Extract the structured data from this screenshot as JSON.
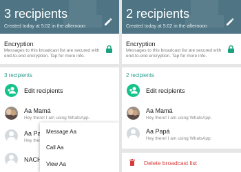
{
  "left": {
    "title": "3 recipients",
    "subtitle": "Created today at 5:02 in the afternoon",
    "encryption_title": "Encryption",
    "encryption_text": "Messages to this broadcast list are secured with end-to-end encryption. Tap for more info.",
    "recipients_count": "3 recipients",
    "edit_recipients": "Edit recipients",
    "contacts": [
      {
        "name": "Aa Mamá",
        "status": "Hey there! I am using WhatsApp."
      },
      {
        "name": "Aa Pap",
        "status": "Hey there!"
      },
      {
        "name": "NACHO",
        "status": ""
      }
    ],
    "menu": [
      "Message Aa",
      "Call Aa",
      "View Aa"
    ]
  },
  "right": {
    "title": "2 recipients",
    "subtitle": "Created today at 5:02 in the afternoon",
    "encryption_title": "Encryption",
    "encryption_text": "Messages to this broadcast list are secured with end-to-end encryption. Tap for more info.",
    "recipients_count": "2 recipients",
    "edit_recipients": "Edit recipients",
    "contacts": [
      {
        "name": "Aa Mamá",
        "status": "Hey there! I am using WhatsApp."
      },
      {
        "name": "Aa Papá",
        "status": "Hey there! I am using WhatsApp."
      }
    ],
    "delete_label": "Delete broadcast list"
  },
  "colors": {
    "header": "#4f7584",
    "accent": "#2b9c8c",
    "green": "#14c28a",
    "danger": "#d63b3b"
  },
  "icons": [
    "edit-icon",
    "lock-icon",
    "add-person-icon",
    "trash-icon"
  ]
}
